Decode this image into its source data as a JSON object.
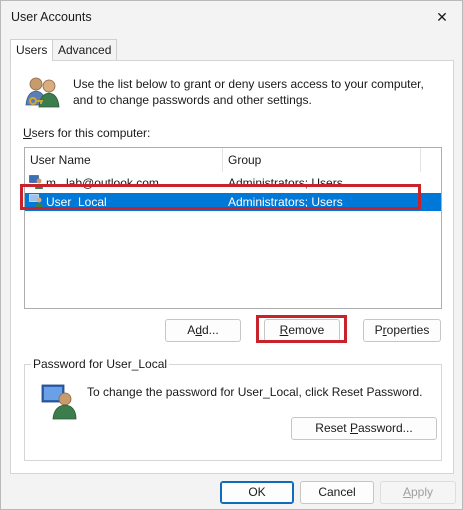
{
  "window": {
    "title": "User Accounts",
    "close_glyph": "✕"
  },
  "tabs": [
    {
      "label": "Users",
      "active": true
    },
    {
      "label": "Advanced",
      "active": false
    }
  ],
  "intro": {
    "icon": "users-keys-icon",
    "text": "Use the list below to grant or deny users access to your computer, and to change passwords and other settings."
  },
  "users": {
    "label": "Users for this computer:",
    "columns": {
      "name": "User Name",
      "group": "Group"
    },
    "rows": [
      {
        "name": "m   lab@outlook.com",
        "group": "Administrators; Users",
        "selected": false,
        "icon": "user-account-icon"
      },
      {
        "name": "User_Local",
        "group": "Administrators; Users",
        "selected": true,
        "icon": "user-account-icon"
      }
    ]
  },
  "buttons": {
    "add": "Add...",
    "remove": "Remove",
    "properties": "Properties"
  },
  "password": {
    "legend": "Password for User_Local",
    "text": "To change the password for User_Local, click Reset Password.",
    "reset": "Reset Password...",
    "icon": "user-password-icon"
  },
  "footer": {
    "ok": "OK",
    "cancel": "Cancel",
    "apply": "Apply"
  },
  "colors": {
    "selection": "#0078d7",
    "annotation": "#c8232c",
    "focus": "#0f6cbd"
  }
}
